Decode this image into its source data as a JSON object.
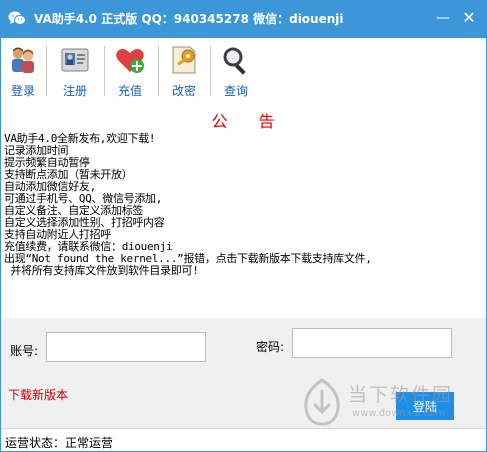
{
  "window": {
    "title": "VA助手4.0 正式版 QQ：940345278 微信：diouenji",
    "minimize_glyph": "—",
    "close_glyph": "✕",
    "app_icon": "wechat-icon",
    "accent_color": "#3b97d8"
  },
  "toolbar": {
    "items": [
      {
        "label": "登录",
        "icon": "users-icon"
      },
      {
        "label": "注册",
        "icon": "id-card-icon"
      },
      {
        "label": "充值",
        "icon": "heart-plus-icon"
      },
      {
        "label": "改密",
        "icon": "key-icon"
      },
      {
        "label": "查询",
        "icon": "magnifier-icon"
      }
    ],
    "label_color": "#1a5fb4"
  },
  "notice": {
    "title": "公 告",
    "title_color": "#e00000",
    "lines": [
      "VA助手4.0全新发布,欢迎下载!",
      "记录添加时间",
      "提示频繁自动暂停",
      "支持断点添加（暂未开放）",
      "自动添加微信好友,",
      "可通过手机号、QQ、微信号添加,",
      "自定义备注、自定义添加标签",
      "自定义选择添加性别、打招呼内容",
      "支持自动附近人打招呼",
      "充值续费，请联系微信：diouenji",
      "出现“Not found the kernel...”报错，点击下载新版本下载支持库文件,",
      " 并将所有支持库文件放到软件目录即可!"
    ]
  },
  "login": {
    "account_label": "账号:",
    "account_value": "",
    "password_label": "密码:",
    "password_value": "",
    "download_link": "下载新版本",
    "download_color": "#cc0000",
    "login_button": "登陆",
    "button_color": "#1e8fe8"
  },
  "watermark": {
    "text": "当下软件园",
    "url": "www.downxia.com"
  },
  "status": {
    "text": "运营状态：正常运营"
  }
}
